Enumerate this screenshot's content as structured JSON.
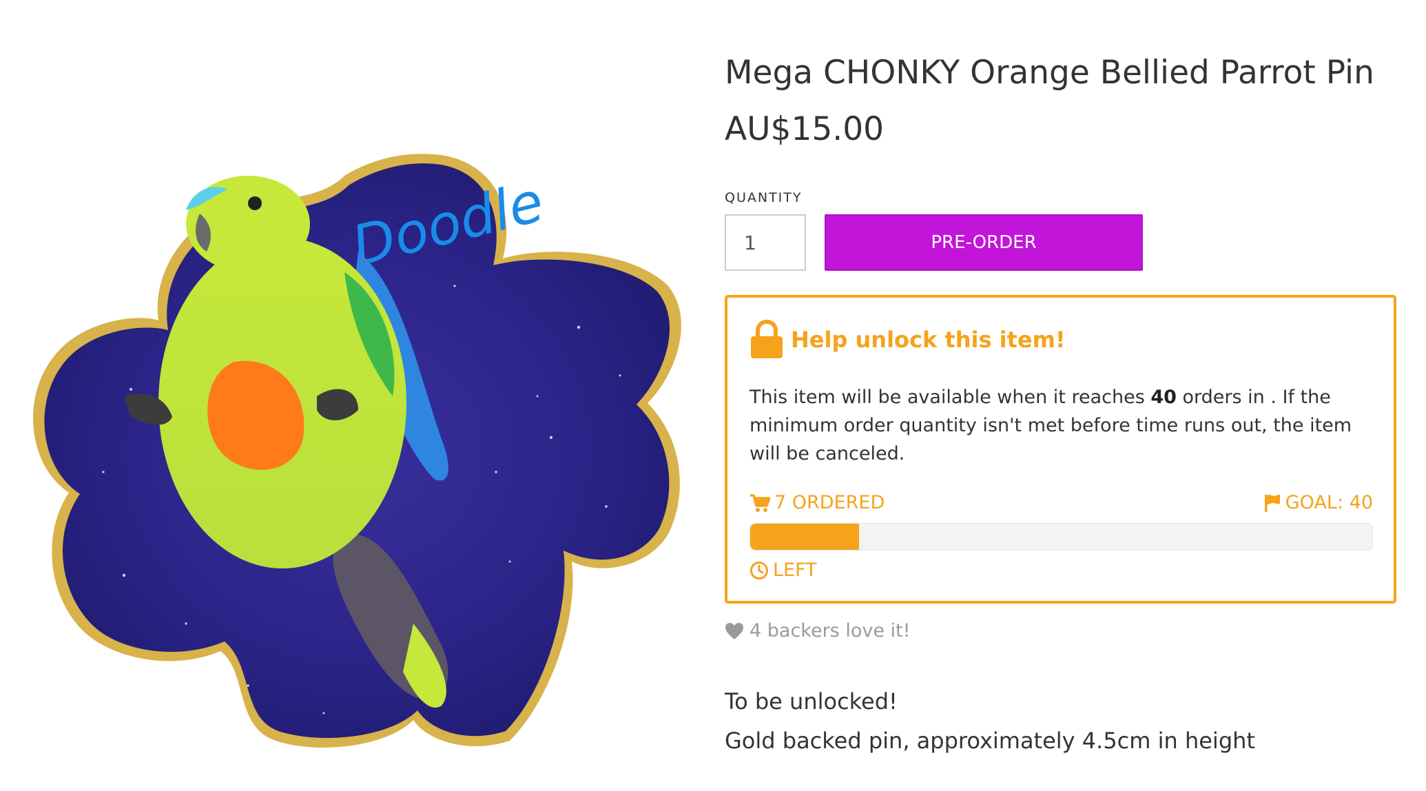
{
  "product": {
    "title": "Mega CHONKY Orange Bellied Parrot Pin",
    "price": "AU$15.00",
    "image_alt": "Cartoon orange bellied parrot on a galaxy pin background with the signature Doodle"
  },
  "purchase": {
    "quantity_label": "QUANTITY",
    "quantity_value": "1",
    "preorder_label": "PRE-ORDER"
  },
  "unlock": {
    "title": "Help unlock this item!",
    "text_before": "This item will be available when it reaches ",
    "goal_bold": "40",
    "text_after": " orders in . If the minimum order quantity isn't met before time runs out, the item will be canceled.",
    "ordered_label": "7 ORDERED",
    "goal_label": "GOAL: 40",
    "time_left_label": "LEFT",
    "ordered_count": 7,
    "goal_count": 40
  },
  "backers": {
    "label": "4 backers love it!"
  },
  "description": {
    "line1": "To be unlocked!",
    "line2": "Gold backed pin, approximately 4.5cm in height"
  },
  "colors": {
    "accent": "#f5a31b",
    "button": "#c215d9",
    "text": "#333333",
    "muted": "#9a9a9a"
  },
  "icons": {
    "lock": "lock-icon",
    "cart": "cart-icon",
    "flag": "flag-icon",
    "clock": "clock-icon",
    "heart": "heart-icon"
  }
}
